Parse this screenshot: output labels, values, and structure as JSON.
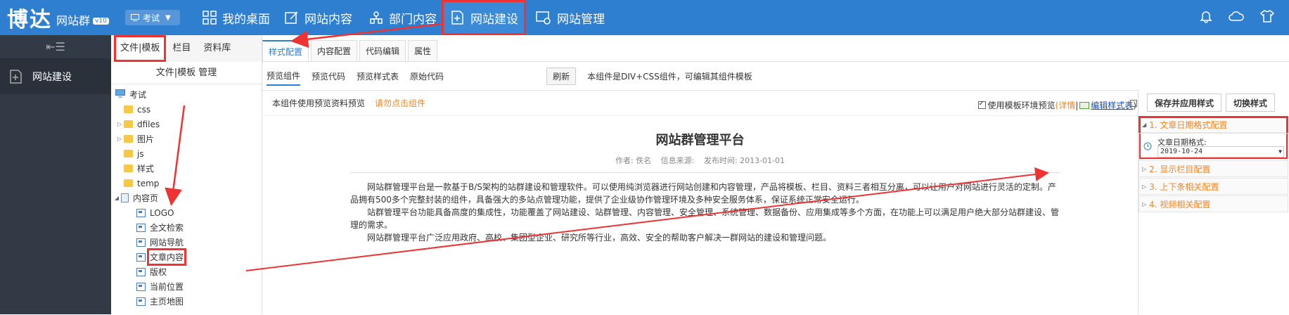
{
  "header": {
    "logo_main": "博达",
    "logo_sub": "网站群",
    "logo_version": "v10",
    "site_selector": "考试",
    "nav": [
      {
        "label": "我的桌面",
        "icon": "grid-icon"
      },
      {
        "label": "网站内容",
        "icon": "edit-icon"
      },
      {
        "label": "部门内容",
        "icon": "department-icon"
      },
      {
        "label": "网站建设",
        "icon": "build-icon"
      },
      {
        "label": "网站管理",
        "icon": "manage-icon"
      }
    ],
    "icons": [
      "bell-icon",
      "cloud-icon",
      "shirt-icon"
    ]
  },
  "sidebar": {
    "item_label": "网站建设"
  },
  "tree_panel": {
    "tabs": [
      "文件|模板",
      "栏目",
      "资料库"
    ],
    "title": "文件|模板 管理",
    "nodes": [
      {
        "label": "考试",
        "type": "site"
      },
      {
        "label": "css",
        "type": "folder"
      },
      {
        "label": "dfiles",
        "type": "folder"
      },
      {
        "label": "图片",
        "type": "folder"
      },
      {
        "label": "js",
        "type": "folder"
      },
      {
        "label": "样式",
        "type": "folder"
      },
      {
        "label": "temp",
        "type": "folder"
      },
      {
        "label": "内容页",
        "type": "page"
      },
      {
        "label": "LOGO",
        "type": "component"
      },
      {
        "label": "全文检索",
        "type": "component"
      },
      {
        "label": "网站导航",
        "type": "component"
      },
      {
        "label": "文章内容",
        "type": "component"
      },
      {
        "label": "版权",
        "type": "component"
      },
      {
        "label": "当前位置",
        "type": "component"
      },
      {
        "label": "主页地图",
        "type": "component"
      }
    ]
  },
  "editor": {
    "tabs": [
      "样式配置",
      "内容配置",
      "代码编辑",
      "属性"
    ],
    "preview_tabs": [
      "预览组件",
      "预览代码",
      "预览样式表",
      "原始代码"
    ],
    "refresh_label": "刷新",
    "description": "本组件是DIV+CSS组件，可编辑其组件模板",
    "canvas_note": "本组件使用预览资料预览",
    "canvas_hint": "请勿点击组件",
    "env_preview_label": "使用模板环境预览",
    "details_link": "详情",
    "edit_style_link": "编辑样式表"
  },
  "article": {
    "title": "网站群管理平台",
    "author": "作者: 佚名",
    "source": "信息来源:",
    "date": "发布时间: 2013-01-01",
    "paragraphs": [
      "网站群管理平台是一款基于B/S架构的站群建设和管理软件。可以使用纯浏览器进行网站创建和内容管理，产品将模板、栏目、资料三者相互分离，可以让用户对网站进行灵活的定制。产品拥有500多个完整封装的组件，具备强大的多站点管理功能，提供了企业级协作管理环境及多种安全服务体系，保证系统正常安全运行。",
      "站群管理平台功能具备高度的集成性，功能覆盖了网站建设、站群管理、内容管理、安全管理、系统管理、数据备份、应用集成等多个方面，在功能上可以满足用户绝大部分站群建设、管理的需求。",
      "网站群管理平台广泛应用政府、高校、集团型企业、研究所等行业，高效、安全的帮助客户解决一群网站的建设和管理问题。"
    ]
  },
  "right_panel": {
    "save_button": "保存并应用样式",
    "switch_button": "切换样式",
    "sections": [
      "1. 文章日期格式配置",
      "2. 显示栏目配置",
      "3. 上下条相关配置",
      "4. 视频相关配置"
    ],
    "date_format_label": "文章日期格式:",
    "date_format_value": "2019-10-24"
  },
  "colors": {
    "topbar": "#2f7fd0",
    "highlight": "#e33333",
    "accent_orange": "#f5861f",
    "sidebar_dark": "#323a46"
  }
}
